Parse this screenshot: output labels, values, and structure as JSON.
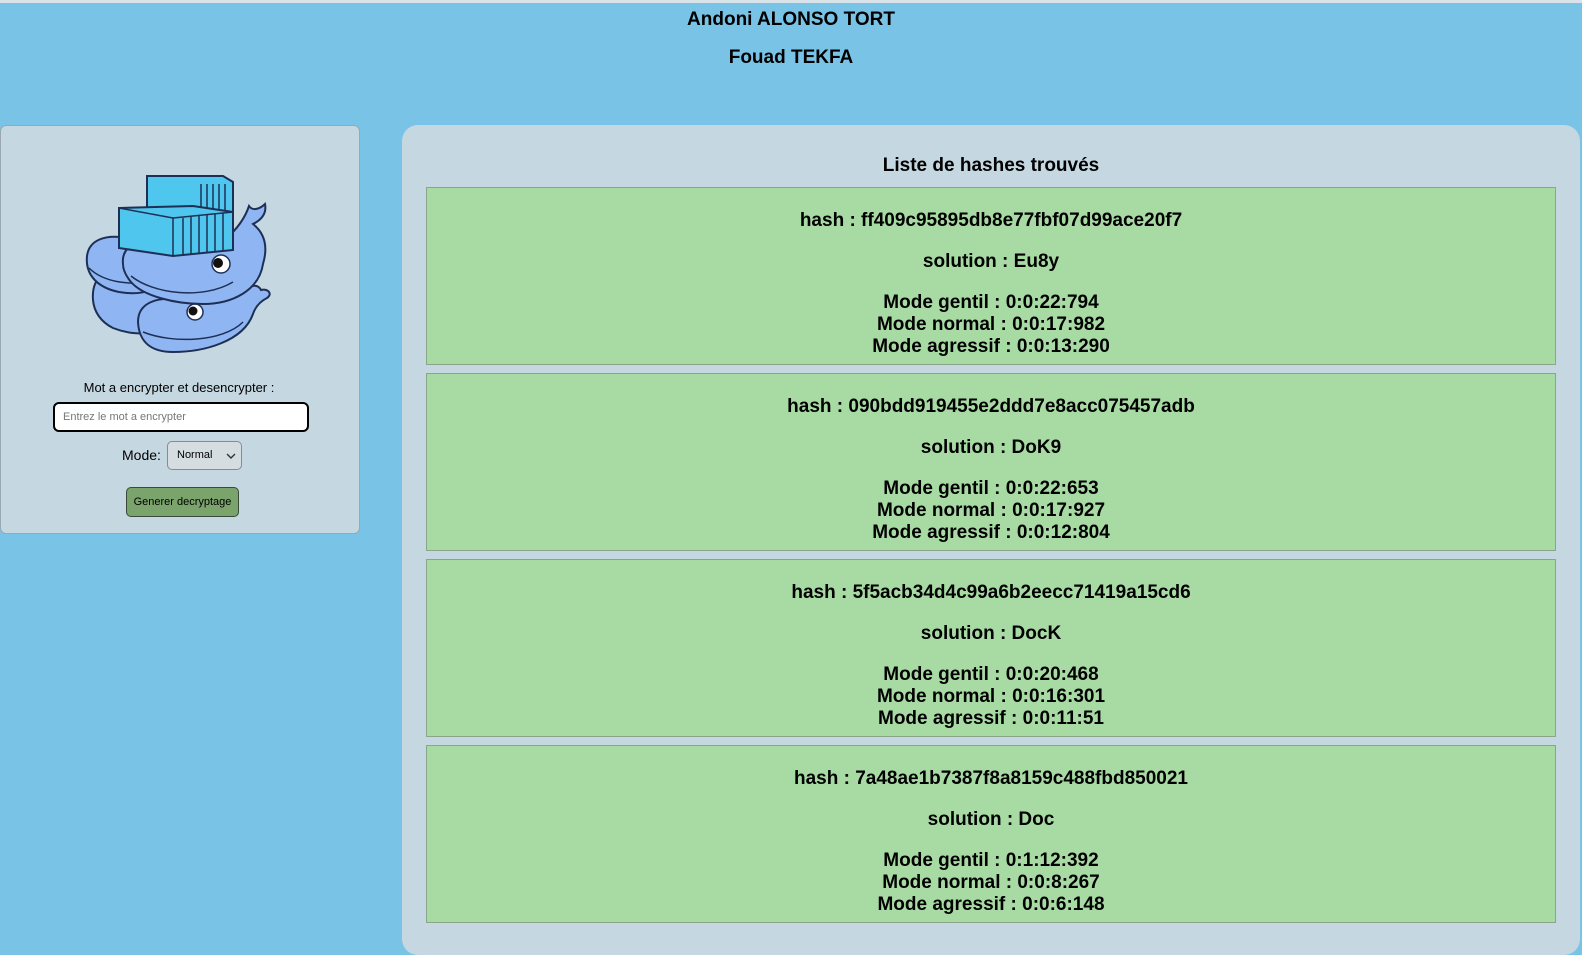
{
  "header": {
    "author_1": "Andoni ALONSO TORT",
    "author_2": "Fouad TEKFA"
  },
  "form": {
    "logo_icon": "docker-whales-logo",
    "word_label": "Mot a encrypter et desencrypter :",
    "word_placeholder": "Entrez le mot a encrypter",
    "word_value": "",
    "mode_label": "Mode:",
    "mode_selected": "Normal",
    "generate_button": "Generer decryptage"
  },
  "results": {
    "title": "Liste de hashes trouvés",
    "items": [
      {
        "hash": "hash : ff409c95895db8e77fbf07d99ace20f7",
        "solution": "solution : Eu8y",
        "gentil": "Mode gentil : 0:0:22:794",
        "normal": "Mode normal : 0:0:17:982",
        "agressif": "Mode agressif : 0:0:13:290"
      },
      {
        "hash": "hash : 090bdd919455e2ddd7e8acc075457adb",
        "solution": "solution : DoK9",
        "gentil": "Mode gentil : 0:0:22:653",
        "normal": "Mode normal : 0:0:17:927",
        "agressif": "Mode agressif : 0:0:12:804"
      },
      {
        "hash": "hash : 5f5acb34d4c99a6b2eecc71419a15cd6",
        "solution": "solution : DocK",
        "gentil": "Mode gentil : 0:0:20:468",
        "normal": "Mode normal : 0:0:16:301",
        "agressif": "Mode agressif : 0:0:11:51"
      },
      {
        "hash": "hash : 7a48ae1b7387f8a8159c488fbd850021",
        "solution": "solution : Doc",
        "gentil": "Mode gentil : 0:1:12:392",
        "normal": "Mode normal : 0:0:8:267",
        "agressif": "Mode agressif : 0:0:6:148"
      }
    ]
  },
  "colors": {
    "background": "#78c3e6",
    "panel": "#c5d7e0",
    "card": "#a8dba4",
    "button": "#7ba46c"
  }
}
